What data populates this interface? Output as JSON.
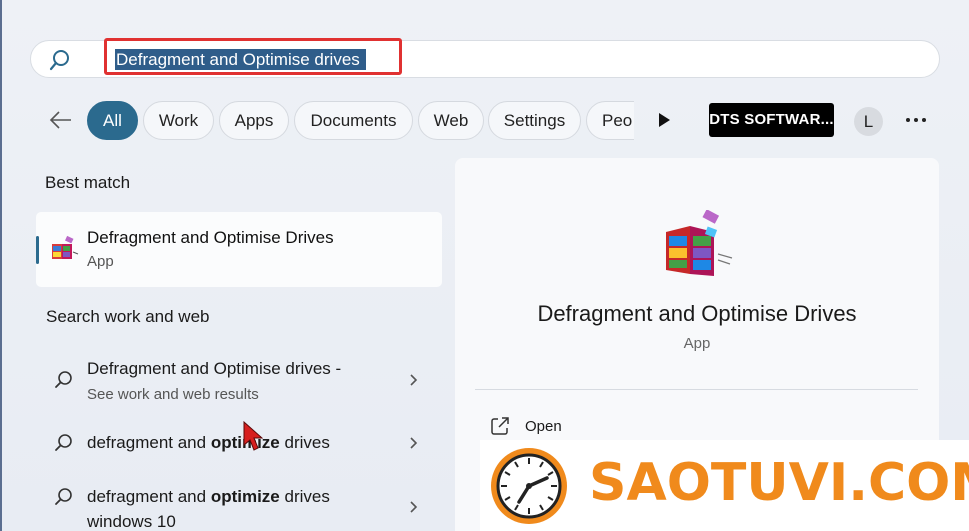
{
  "search": {
    "query": "Defragment and Optimise drives"
  },
  "filters": {
    "tabs": [
      {
        "label": "All",
        "active": true
      },
      {
        "label": "Work"
      },
      {
        "label": "Apps"
      },
      {
        "label": "Documents"
      },
      {
        "label": "Web"
      },
      {
        "label": "Settings"
      },
      {
        "label": "Peo"
      }
    ],
    "org_badge": "DTS SOFTWAR...",
    "avatar_initial": "L"
  },
  "best_match": {
    "heading": "Best match",
    "name": "Defragment and Optimise Drives",
    "type": "App"
  },
  "search_web": {
    "heading": "Search work and web",
    "results": [
      {
        "line1": "Defragment and Optimise drives -",
        "line2": "See work and web results"
      },
      {
        "prefix": "defragment and ",
        "bold": "opt",
        "suffix_bold": "imize",
        "rest": " drives"
      },
      {
        "prefix": "defragment and ",
        "bold": "optimize",
        "rest": " drives",
        "line2": "windows 10"
      }
    ]
  },
  "detail": {
    "title": "Defragment and Optimise Drives",
    "type": "App",
    "actions": [
      {
        "label": "Open",
        "icon": "open-external-icon"
      }
    ]
  },
  "watermark": {
    "text": "SAOTUVI.COM"
  },
  "colors": {
    "accent": "#2b6a8e",
    "highlight_box": "#e03131",
    "watermark": "#f08a1c"
  }
}
